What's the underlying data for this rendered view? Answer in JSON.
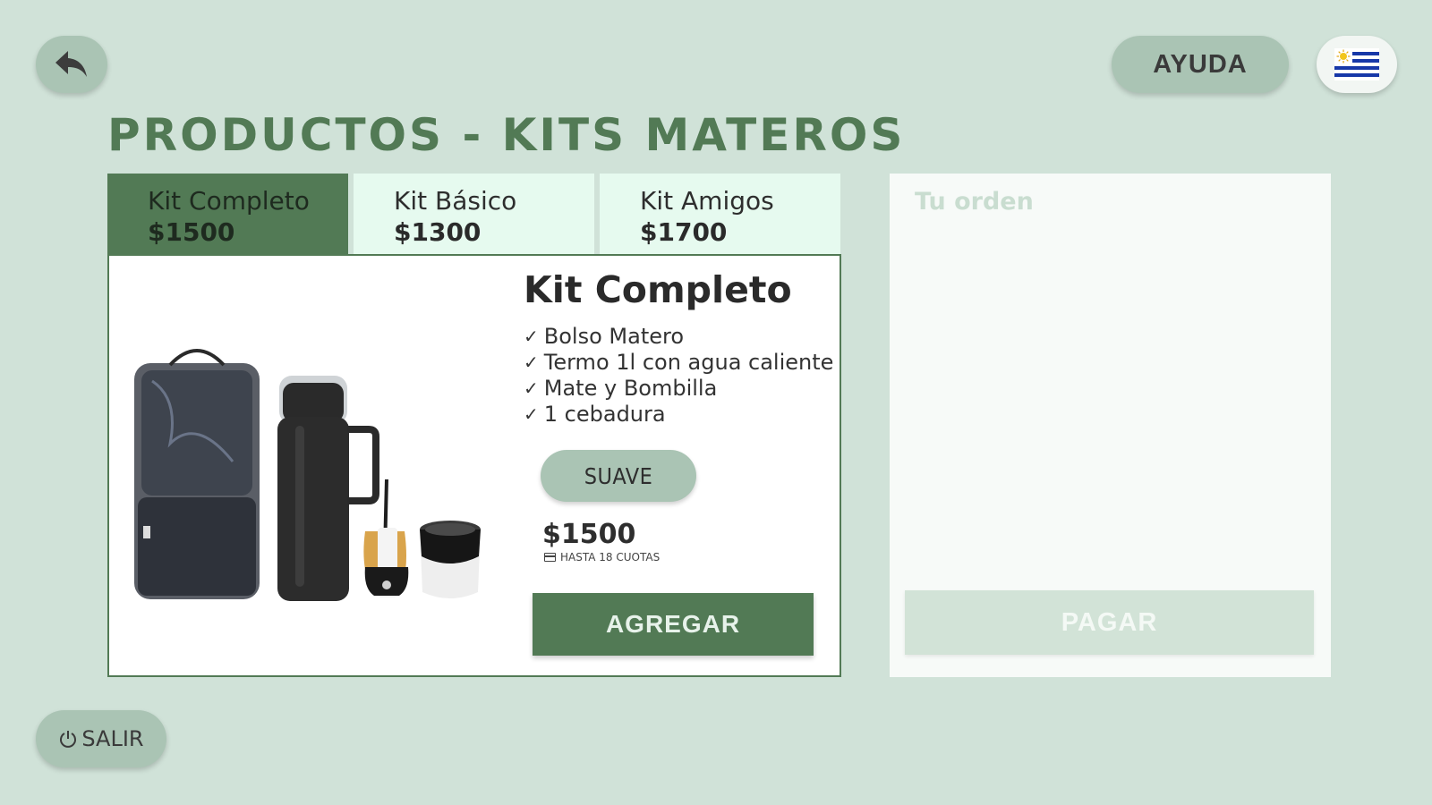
{
  "header": {
    "back_icon": "reply-arrow-icon",
    "help_label": "AYUDA",
    "language_icon": "uruguay-flag-icon"
  },
  "page": {
    "title": "PRODUCTOS - KITS MATEROS"
  },
  "tabs": [
    {
      "name": "Kit Completo",
      "price": "$1500",
      "active": true
    },
    {
      "name": "Kit Básico",
      "price": "$1300",
      "active": false
    },
    {
      "name": "Kit Amigos",
      "price": "$1700",
      "active": false
    }
  ],
  "product": {
    "title": "Kit Completo",
    "features": [
      "Bolso Matero",
      "Termo 1l con agua caliente",
      "Mate y Bombilla",
      "1 cebadura"
    ],
    "flavor_label": "SUAVE",
    "price": "$1500",
    "installments": "HASTA 18 CUOTAS",
    "add_label": "AGREGAR"
  },
  "order": {
    "title": "Tu orden",
    "pay_label": "PAGAR"
  },
  "footer": {
    "exit_label": "SALIR"
  },
  "colors": {
    "background": "#d0e2d8",
    "accent": "#527a55",
    "pill": "#aac4b4",
    "tab_inactive": "#e6faef"
  }
}
